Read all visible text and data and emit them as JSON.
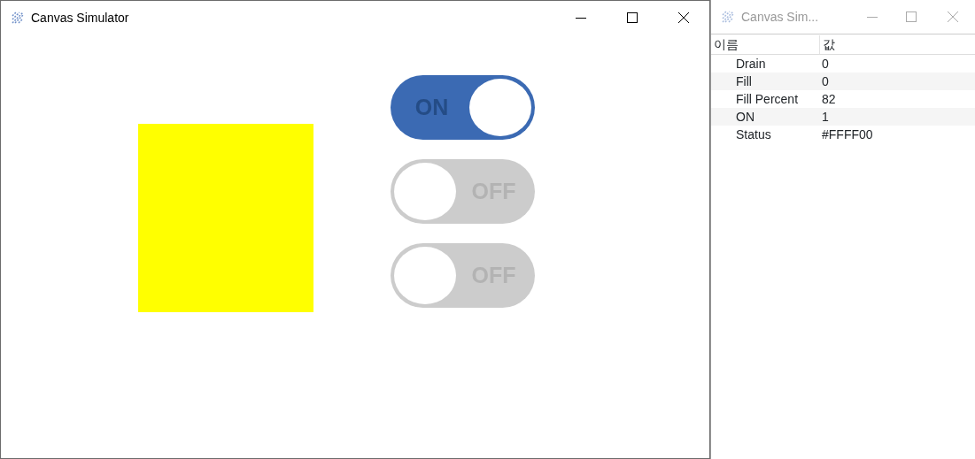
{
  "main_window": {
    "title": "Canvas Simulator",
    "canvas": {
      "toggles": [
        {
          "label": "ON",
          "on": true
        },
        {
          "label": "OFF",
          "on": false
        },
        {
          "label": "OFF",
          "on": false
        }
      ]
    }
  },
  "properties_window": {
    "title": "Canvas Sim...",
    "columns": [
      "이름",
      "값"
    ],
    "rows": [
      {
        "name": "Drain",
        "value": "0"
      },
      {
        "name": "Fill",
        "value": "0"
      },
      {
        "name": "Fill Percent",
        "value": "82"
      },
      {
        "name": "ON",
        "value": "1"
      },
      {
        "name": "Status",
        "value": "#FFFF00"
      }
    ]
  }
}
